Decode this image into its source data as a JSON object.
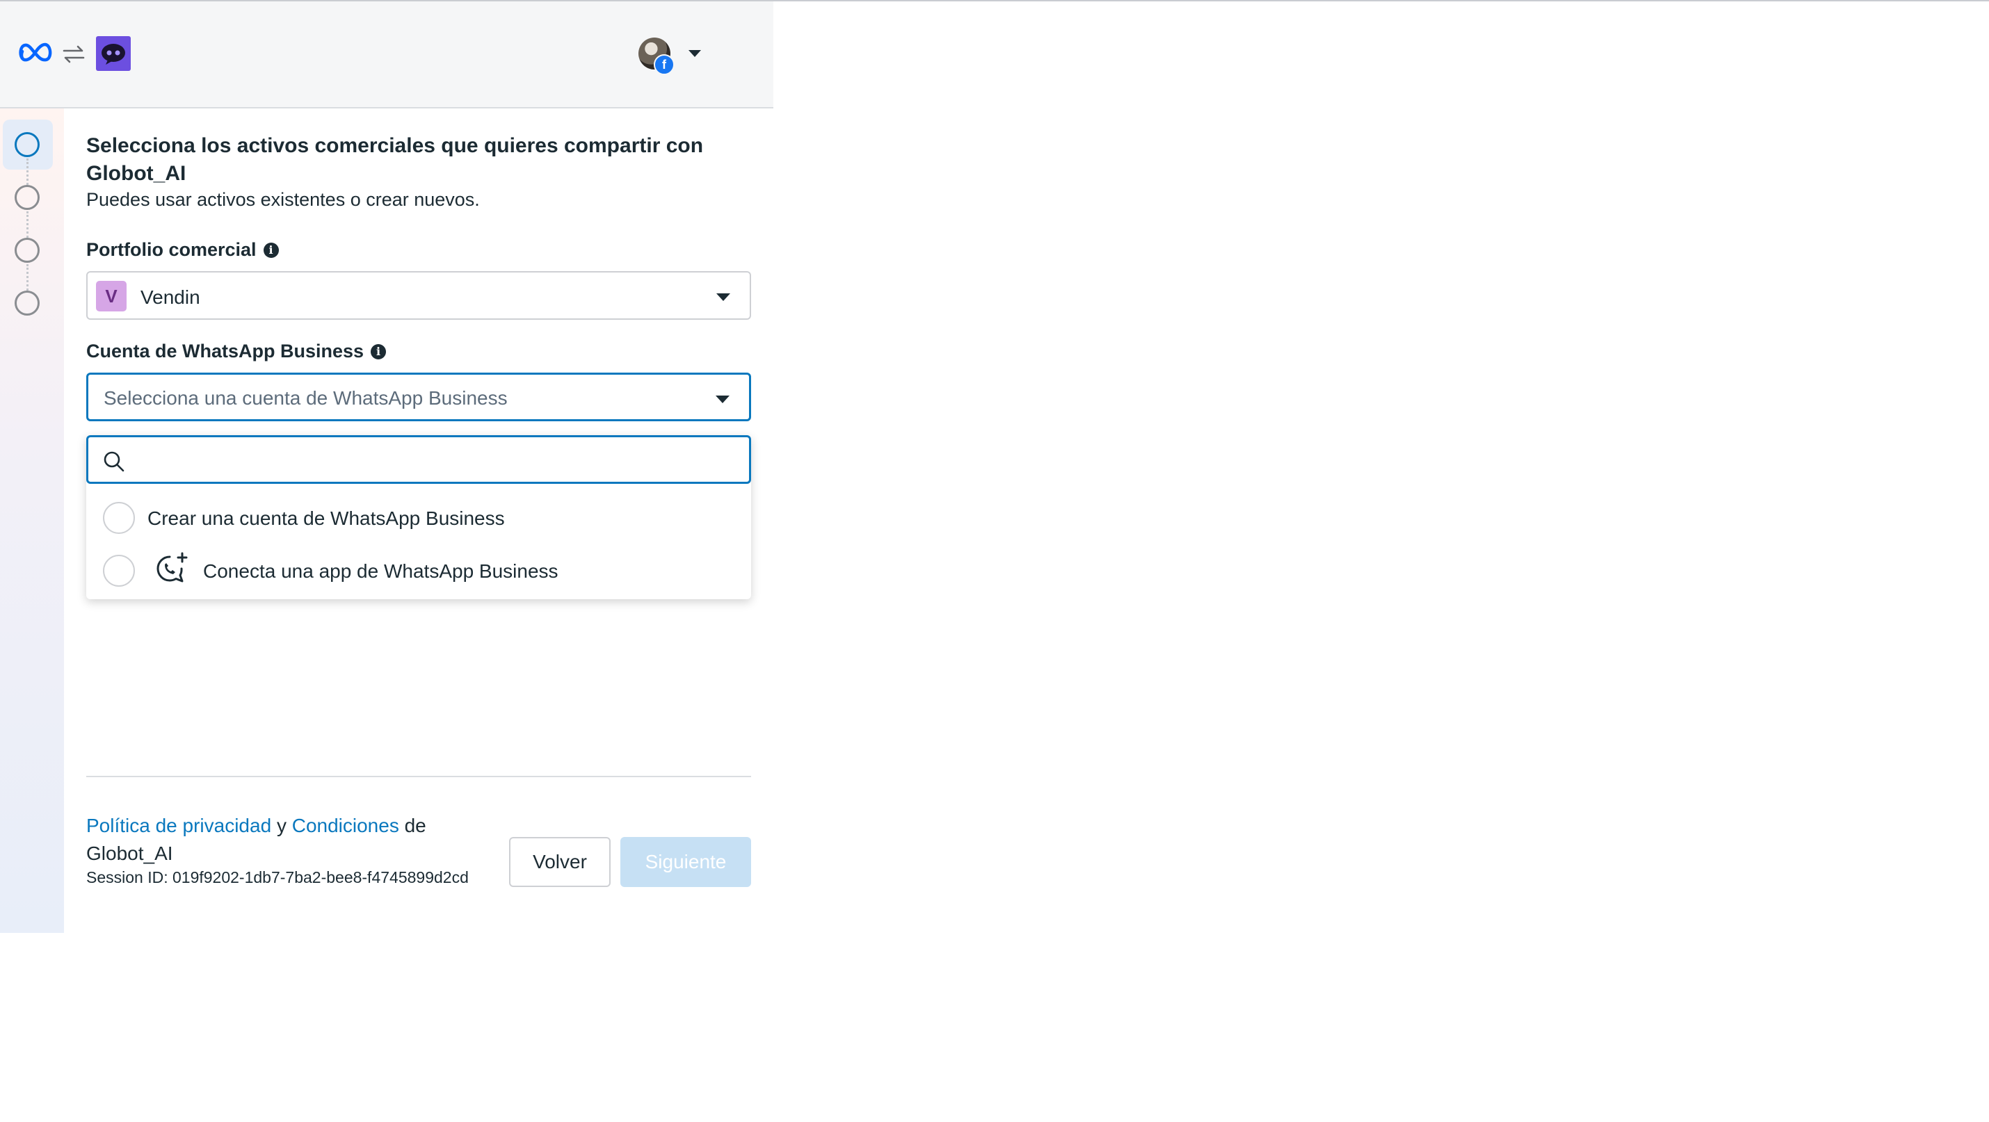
{
  "header": {
    "logo": "meta-logo",
    "connector_icon": "swap-arrows-icon",
    "app_icon": "globot-app-icon",
    "account_avatar": "user-avatar",
    "account_badge": "f",
    "account_menu_icon": "caret-down-icon"
  },
  "steps": [
    {
      "state": "active"
    },
    {
      "state": "pending"
    },
    {
      "state": "pending"
    },
    {
      "state": "pending"
    }
  ],
  "main": {
    "title": "Selecciona los activos comerciales que quieres compartir con Globot_AI",
    "subtitle": "Puedes usar activos existentes o crear nuevos.",
    "portfolio": {
      "label": "Portfolio comercial",
      "badge": "V",
      "value": "Vendin"
    },
    "whatsapp": {
      "label": "Cuenta de WhatsApp Business",
      "placeholder": "Selecciona una cuenta de WhatsApp Business"
    },
    "dropdown": {
      "search_value": "",
      "options": [
        {
          "label": "Crear una cuenta de WhatsApp Business"
        },
        {
          "label": "Conecta una app de WhatsApp Business",
          "icon": "whatsapp-add-icon"
        }
      ]
    }
  },
  "footer": {
    "privacy_link": "Política de privacidad",
    "conjunction": "y",
    "terms_link": "Condiciones",
    "suffix": "de Globot_AI",
    "session": "Session ID: 019f9202-1db7-7ba2-bee8-f4745899d2cd",
    "back_label": "Volver",
    "next_label": "Siguiente"
  },
  "colors": {
    "accent": "#0a78be",
    "disabled_button": "#c6e0f4",
    "app_icon": "#6c4fe0",
    "portfolio_badge": "#d6a6e6"
  }
}
